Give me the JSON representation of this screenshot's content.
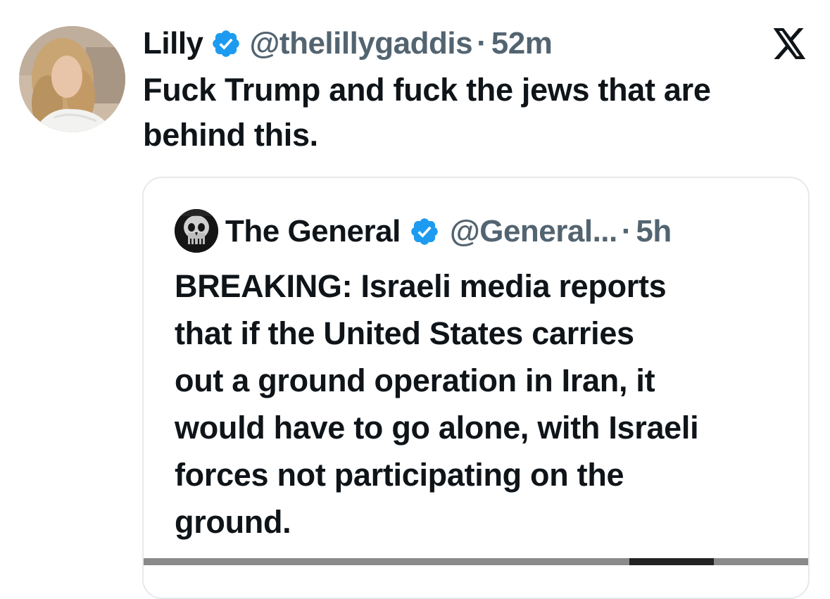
{
  "tweet": {
    "display_name": "Lilly",
    "handle": "@thelillygaddis",
    "separator": "·",
    "time": "52m",
    "text_line_1": "Fuck Trump and fuck the jews that are",
    "text_line_2": "behind this.",
    "avatar_icon": "user-photo-avatar",
    "verified_icon": "verified-badge-icon",
    "platform_icon": "x-logo-icon"
  },
  "quote": {
    "display_name": "The General",
    "handle": "@General...",
    "separator": "·",
    "time": "5h",
    "text_lines": [
      "BREAKING: Israeli media reports",
      "that if the United States carries",
      "out a ground operation in Iran, it",
      "would have to go alone, with Israeli",
      "forces not participating on the",
      "ground."
    ],
    "avatar_icon": "punisher-skull-avatar",
    "verified_icon": "verified-badge-icon"
  },
  "colors": {
    "text_primary": "#0f1419",
    "text_secondary": "#536471",
    "verified_blue": "#1d9bf0",
    "card_border": "#e6e9eb"
  }
}
